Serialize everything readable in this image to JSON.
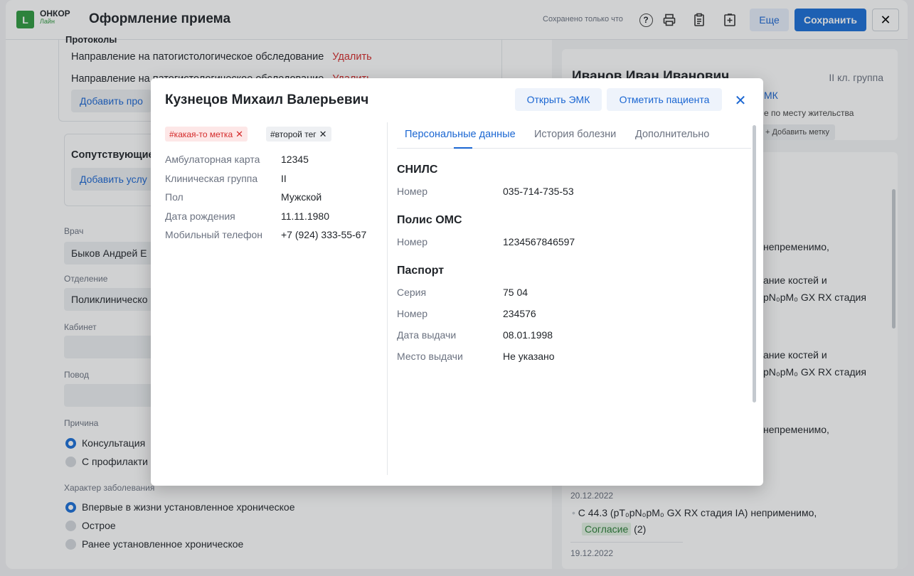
{
  "header": {
    "logo_letter": "L",
    "logo_main": "ОНКОР",
    "logo_sub": "Лайн",
    "title": "Оформление приема",
    "saved_status": "Сохранено только что",
    "more_label": "Еще",
    "save_label": "Сохранить"
  },
  "form": {
    "protocols_heading": "Протоколы",
    "protocols": [
      {
        "name": "Направление на патогистологическое обследование",
        "delete_label": "Удалить"
      },
      {
        "name": "Направление на патогистологическое обследование",
        "delete_label": "Удалить"
      }
    ],
    "add_protocol_label": "Добавить про",
    "services_heading": "Сопутствующие у",
    "add_service_label": "Добавить услу",
    "doctor_label": "Врач",
    "doctor_value": "Быков Андрей Е",
    "department_label": "Отделение",
    "department_value": "Поликлиническо",
    "cabinet_label": "Кабинет",
    "reason_label": "Повод",
    "cause_label": "Причина",
    "cause_options": [
      "Консультация",
      "С профилакти"
    ],
    "disease_label": "Характер заболевания",
    "disease_options": [
      "Впервые в жизни установленное хроническое",
      "Острое",
      "Ранее установленное хроническое"
    ]
  },
  "patient_card": {
    "name": "Иванов Иван Иванович",
    "group": "II кл. группа",
    "emk_link": "МК",
    "residence": "е по месту жительства",
    "add_tag_label": "+ Добавить метку"
  },
  "history": {
    "line1": "непременимо,",
    "line2a": "ание костей и",
    "line2b": "pN₀pM₀ GX RX стадия",
    "line3a": "ание костей и",
    "line3b": "pN₀pM₀ GX RX стадия",
    "line4": "непременимо,",
    "date1": "20.12.2022",
    "entry_text": "C 44.3 (pT₀pN₀pM₀ GX RX стадия IA) неприменимо,",
    "consent_label": "Согласие",
    "consent_count": "(2)",
    "date2": "19.12.2022"
  },
  "modal": {
    "title": "Кузнецов Михаил Валерьевич",
    "open_emk_label": "Открыть ЭМК",
    "mark_patient_label": "Отметить пациента",
    "tags": [
      "#какая-то метка",
      "#второй тег"
    ],
    "info": [
      {
        "label": "Амбулаторная карта",
        "value": "12345"
      },
      {
        "label": "Клиническая группа",
        "value": "II"
      },
      {
        "label": "Пол",
        "value": "Мужской"
      },
      {
        "label": "Дата рождения",
        "value": "11.11.1980"
      },
      {
        "label": "Мобильный телефон",
        "value": "+7 (924) 333-55-67"
      }
    ],
    "tabs": [
      "Персональные данные",
      "История болезни",
      "Дополнительно"
    ],
    "snils": {
      "title": "СНИЛС",
      "number_label": "Номер",
      "number": "035-714-735-53"
    },
    "oms": {
      "title": "Полис ОМС",
      "number_label": "Номер",
      "number": "1234567846597"
    },
    "passport": {
      "title": "Паспорт",
      "series_label": "Серия",
      "series": "75 04",
      "number_label": "Номер",
      "number": "234576",
      "issue_date_label": "Дата выдачи",
      "issue_date": "08.01.1998",
      "issue_place_label": "Место выдачи",
      "issue_place": "Не указано"
    }
  },
  "colors": {
    "accent": "#1a6fd8",
    "brand": "#2f9a3f",
    "danger": "#d42b2b"
  }
}
